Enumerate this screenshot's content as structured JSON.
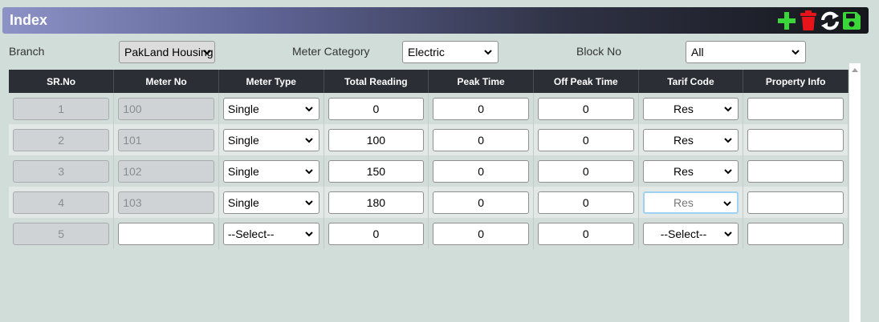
{
  "header": {
    "title": "Index",
    "icons": [
      "plus-icon",
      "trash-icon",
      "refresh-icon",
      "save-icon"
    ]
  },
  "filters": {
    "branch_label": "Branch",
    "branch_value": "PakLand Housing",
    "meter_category_label": "Meter Category",
    "meter_category_value": "Electric",
    "block_label": "Block No",
    "block_value": "All"
  },
  "table": {
    "columns": [
      "SR.No",
      "Meter No",
      "Meter Type",
      "Total Reading",
      "Peak Time",
      "Off Peak Time",
      "Tarif Code",
      "Property Info"
    ],
    "rows": [
      {
        "sr": "1",
        "meter_no": "100",
        "meter_type": "Single",
        "total": "0",
        "peak": "0",
        "offpeak": "0",
        "tarif": "Res",
        "property": ""
      },
      {
        "sr": "2",
        "meter_no": "101",
        "meter_type": "Single",
        "total": "100",
        "peak": "0",
        "offpeak": "0",
        "tarif": "Res",
        "property": ""
      },
      {
        "sr": "3",
        "meter_no": "102",
        "meter_type": "Single",
        "total": "150",
        "peak": "0",
        "offpeak": "0",
        "tarif": "Res",
        "property": ""
      },
      {
        "sr": "4",
        "meter_no": "103",
        "meter_type": "Single",
        "total": "180",
        "peak": "0",
        "offpeak": "0",
        "tarif": "Res",
        "property": ""
      },
      {
        "sr": "5",
        "meter_no": "",
        "meter_type": "--Select--",
        "total": "0",
        "peak": "0",
        "offpeak": "0",
        "tarif": "--Select--",
        "property": ""
      }
    ]
  },
  "colors": {
    "accent_green": "#3ad63a",
    "delete_red": "#e8141b",
    "header_bg": "#2b2f35"
  }
}
